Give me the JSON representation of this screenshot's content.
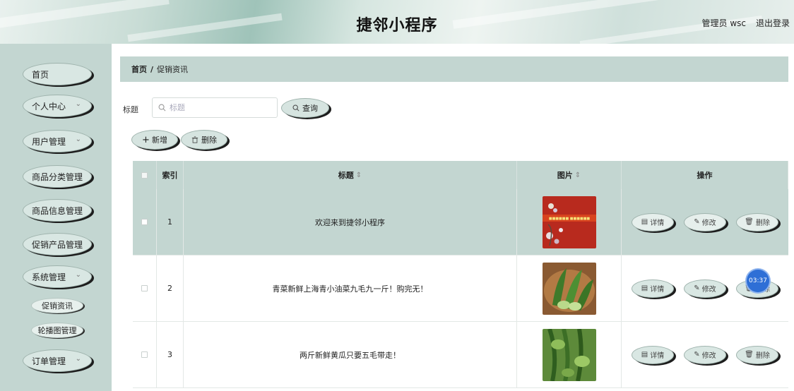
{
  "header": {
    "title": "捷邻小程序",
    "admin": "管理员 wsc",
    "logout": "退出登录"
  },
  "sidebar": {
    "items": [
      {
        "label": "首页",
        "chevron": false
      },
      {
        "label": "个人中心",
        "chevron": true
      },
      {
        "label": "用户管理",
        "chevron": true
      },
      {
        "label": "商品分类管理",
        "chevron": false
      },
      {
        "label": "商品信息管理",
        "chevron": false
      },
      {
        "label": "促销产品管理",
        "chevron": false
      },
      {
        "label": "系统管理",
        "chevron": true
      },
      {
        "label": "订单管理",
        "chevron": true
      }
    ],
    "sub_items": [
      {
        "label": "促销资讯"
      },
      {
        "label": "轮播图管理"
      }
    ],
    "chevron_glyph": "⌄"
  },
  "breadcrumb": {
    "home": "首页",
    "separator": "/",
    "current": "促销资讯"
  },
  "search": {
    "label": "标题",
    "placeholder": "标题",
    "button": "查询",
    "icon": "search-icon"
  },
  "toolbar": {
    "add": "新增",
    "delete": "删除"
  },
  "table": {
    "columns": {
      "index": "索引",
      "title": "标题",
      "image": "图片",
      "actions": "操作"
    },
    "rows": [
      {
        "index": "1",
        "title": "欢迎来到捷邻小程序",
        "image": "red-banner-photo"
      },
      {
        "index": "2",
        "title": "青菜新鲜上海青小油菜九毛九一斤！购完无！",
        "image": "bok-choy-photo"
      },
      {
        "index": "3",
        "title": "两斤新鲜黄瓜只要五毛带走！",
        "image": "cucumber-photo"
      }
    ],
    "row_actions": {
      "detail": "详情",
      "edit": "修改",
      "delete": "删除"
    },
    "highlighted_row": 1
  },
  "overlay": {
    "timer": "03:37"
  },
  "colors": {
    "accent": "#c3d6d1",
    "timer_bg": "#2e6fd6"
  }
}
